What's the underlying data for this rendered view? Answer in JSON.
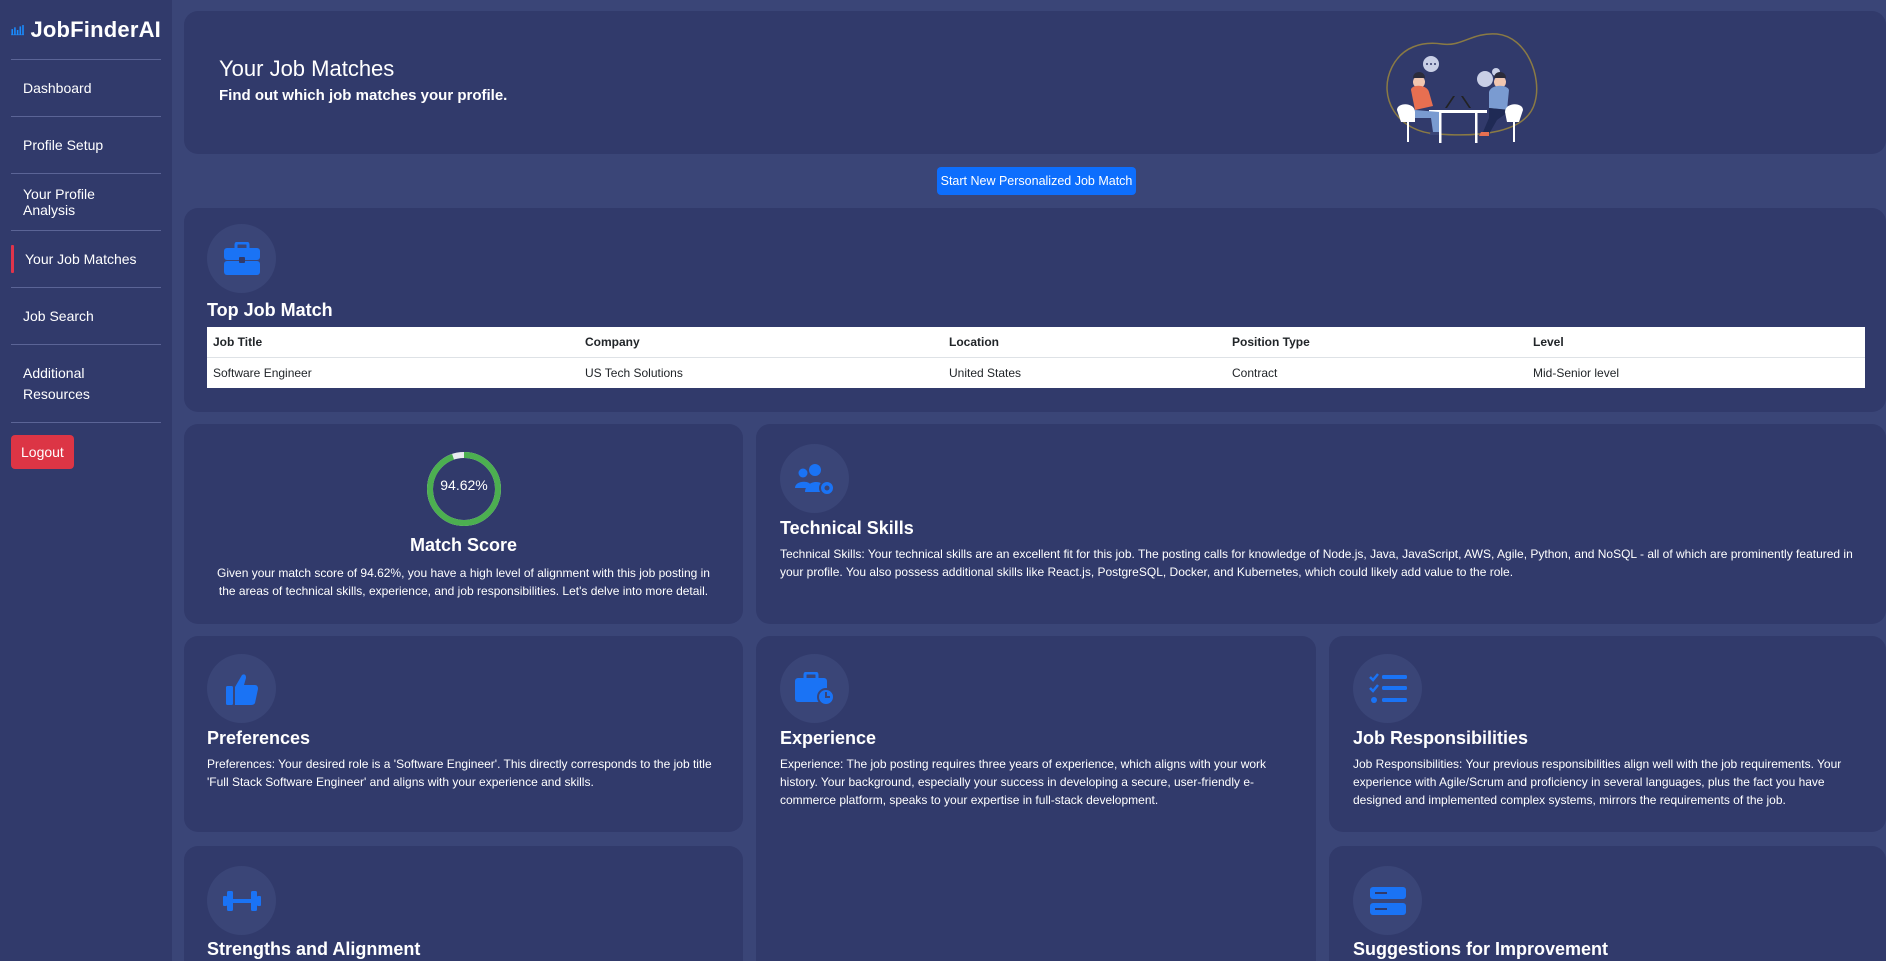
{
  "app": {
    "name": "JobFinderAI"
  },
  "sidebar": {
    "items": [
      {
        "label": "Dashboard",
        "active": false
      },
      {
        "label": "Profile Setup",
        "active": false
      },
      {
        "label": "Your Profile Analysis",
        "active": false
      },
      {
        "label": "Your Job Matches",
        "active": true
      },
      {
        "label": "Job Search",
        "active": false
      },
      {
        "label": "Additional Resources",
        "active": false
      }
    ],
    "logout_label": "Logout"
  },
  "header": {
    "title": "Your Job Matches",
    "subtitle": "Find out which job matches your profile."
  },
  "start_button_label": "Start New Personalized Job Match",
  "top_match": {
    "title": "Top Job Match",
    "columns": [
      "Job Title",
      "Company",
      "Location",
      "Position Type",
      "Level"
    ],
    "row": [
      "Software Engineer",
      "US Tech Solutions",
      "United States",
      "Contract",
      "Mid-Senior level"
    ]
  },
  "match_score": {
    "value_label": "94.62%",
    "value_fraction": 0.9462,
    "title": "Match Score",
    "text": "Given your match score of 94.62%, you have a high level of alignment with this job posting in the areas of technical skills, experience, and job responsibilities. Let's delve into more detail."
  },
  "technical_skills": {
    "title": "Technical Skills",
    "text": "Technical Skills: Your technical skills are an excellent fit for this job. The posting calls for knowledge of Node.js, Java, JavaScript, AWS, Agile, Python, and NoSQL - all of which are prominently featured in your profile. You also possess additional skills like React.js, PostgreSQL, Docker, and Kubernetes, which could likely add value to the role."
  },
  "preferences": {
    "title": "Preferences",
    "text": "Preferences: Your desired role is a 'Software Engineer'. This directly corresponds to the job title 'Full Stack Software Engineer' and aligns with your experience and skills."
  },
  "experience": {
    "title": "Experience",
    "text": "Experience: The job posting requires three years of experience, which aligns with your work history. Your background, especially your success in developing a secure, user-friendly e-commerce platform, speaks to your expertise in full-stack development."
  },
  "job_responsibilities": {
    "title": "Job Responsibilities",
    "text": "Job Responsibilities: Your previous responsibilities align well with the job requirements. Your experience with Agile/Scrum and proficiency in several languages, plus the fact you have designed and implemented complex systems, mirrors the requirements of the job."
  },
  "strengths": {
    "title": "Strengths and Alignment"
  },
  "suggestions": {
    "title": "Suggestions for Improvement"
  },
  "colors": {
    "background": "#3a4577",
    "card": "#313a6b",
    "accent_blue": "#0d6efd",
    "icon_blue": "#1a73f5",
    "score_green": "#4caf50",
    "logout_red": "#dc3545",
    "active_marker": "#e0344b"
  }
}
